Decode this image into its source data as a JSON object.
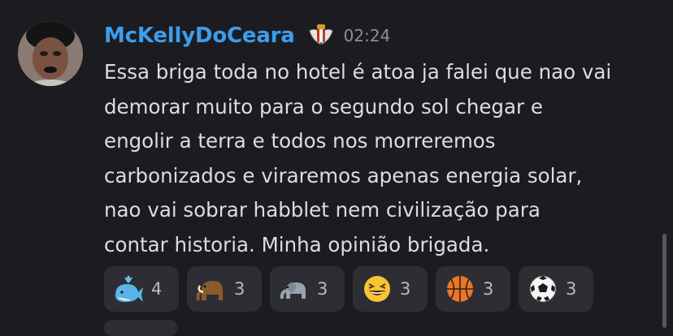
{
  "message": {
    "author": "McKellyDoCeara",
    "timestamp": "02:24",
    "role_icon": "winged-badge-icon",
    "lines": [
      "Essa briga toda no hotel é atoa ja falei que nao vai",
      "demorar muito para o segundo sol chegar e",
      "engolir a terra e todos nos morreremos",
      "carbonizados e viraremos apenas energia solar,",
      "nao vai sobrar habblet nem civilização para",
      "contar historia. Minha opinião brigada."
    ]
  },
  "reactions": [
    {
      "icon": "whale-icon",
      "count": "4"
    },
    {
      "icon": "mammoth-icon",
      "count": "3"
    },
    {
      "icon": "elephant-icon",
      "count": "3"
    },
    {
      "icon": "laughing-face-icon",
      "count": "3"
    },
    {
      "icon": "basketball-icon",
      "count": "3"
    },
    {
      "icon": "soccer-ball-icon",
      "count": "3"
    }
  ],
  "colors": {
    "background": "#1c1c20",
    "username": "#3b9ef0",
    "text": "#dcdde0",
    "timestamp": "#8c8f96",
    "reaction_bg": "#2d2e33"
  }
}
